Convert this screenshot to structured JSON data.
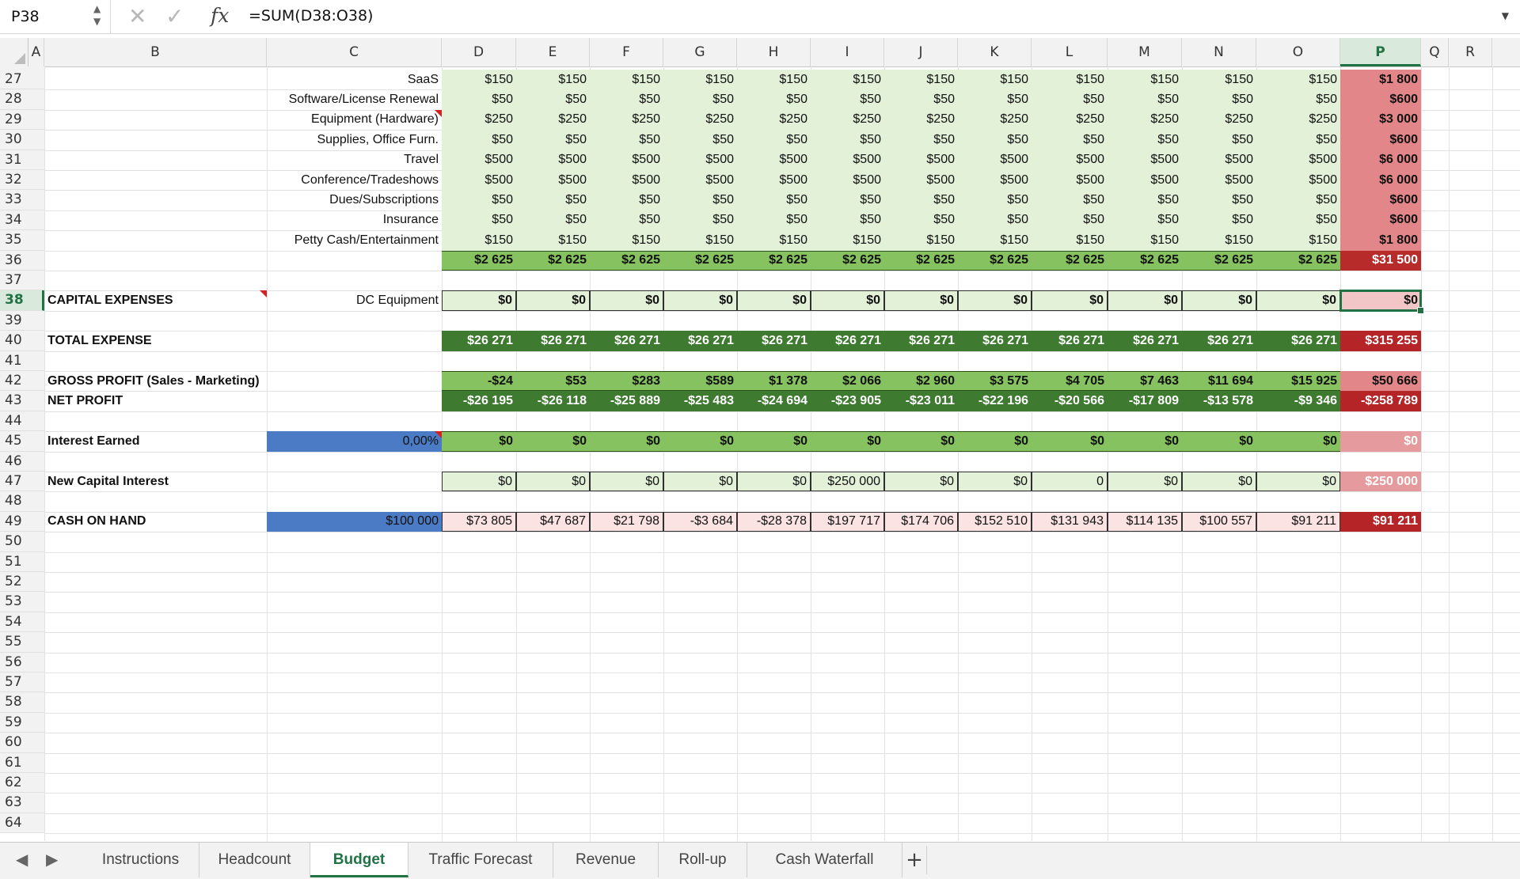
{
  "formula_bar": {
    "name_box": "P38",
    "name_box_stepper": "▲\n▼",
    "cancel_icon": "✕",
    "confirm_icon": "✓",
    "fx_icon": "fx",
    "formula": "=SUM(D38:O38)",
    "expand_icon": "▼"
  },
  "columns": [
    "A",
    "B",
    "C",
    "D",
    "E",
    "F",
    "G",
    "H",
    "I",
    "J",
    "K",
    "L",
    "M",
    "N",
    "O",
    "P",
    "Q",
    "R"
  ],
  "selected_column": "P",
  "rows": [
    {
      "n": "27",
      "c": "SaaS",
      "vals": [
        "$150",
        "$150",
        "$150",
        "$150",
        "$150",
        "$150",
        "$150",
        "$150",
        "$150",
        "$150",
        "$150",
        "$150"
      ],
      "total": "$1 800"
    },
    {
      "n": "28",
      "c": "Software/License Renewal",
      "vals": [
        "$50",
        "$50",
        "$50",
        "$50",
        "$50",
        "$50",
        "$50",
        "$50",
        "$50",
        "$50",
        "$50",
        "$50"
      ],
      "total": "$600"
    },
    {
      "n": "29",
      "c": "Equipment (Hardware)",
      "vals": [
        "$250",
        "$250",
        "$250",
        "$250",
        "$250",
        "$250",
        "$250",
        "$250",
        "$250",
        "$250",
        "$250",
        "$250"
      ],
      "total": "$3 000"
    },
    {
      "n": "30",
      "c": "Supplies, Office Furn.",
      "vals": [
        "$50",
        "$50",
        "$50",
        "$50",
        "$50",
        "$50",
        "$50",
        "$50",
        "$50",
        "$50",
        "$50",
        "$50"
      ],
      "total": "$600"
    },
    {
      "n": "31",
      "c": "Travel",
      "vals": [
        "$500",
        "$500",
        "$500",
        "$500",
        "$500",
        "$500",
        "$500",
        "$500",
        "$500",
        "$500",
        "$500",
        "$500"
      ],
      "total": "$6 000"
    },
    {
      "n": "32",
      "c": "Conference/Tradeshows",
      "vals": [
        "$500",
        "$500",
        "$500",
        "$500",
        "$500",
        "$500",
        "$500",
        "$500",
        "$500",
        "$500",
        "$500",
        "$500"
      ],
      "total": "$6 000"
    },
    {
      "n": "33",
      "c": "Dues/Subscriptions",
      "vals": [
        "$50",
        "$50",
        "$50",
        "$50",
        "$50",
        "$50",
        "$50",
        "$50",
        "$50",
        "$50",
        "$50",
        "$50"
      ],
      "total": "$600"
    },
    {
      "n": "34",
      "c": "Insurance",
      "vals": [
        "$50",
        "$50",
        "$50",
        "$50",
        "$50",
        "$50",
        "$50",
        "$50",
        "$50",
        "$50",
        "$50",
        "$50"
      ],
      "total": "$600"
    },
    {
      "n": "35",
      "c": "Petty Cash/Entertainment",
      "vals": [
        "$150",
        "$150",
        "$150",
        "$150",
        "$150",
        "$150",
        "$150",
        "$150",
        "$150",
        "$150",
        "$150",
        "$150"
      ],
      "total": "$1 800"
    }
  ],
  "subtotal": {
    "n": "36",
    "vals": [
      "$2 625",
      "$2 625",
      "$2 625",
      "$2 625",
      "$2 625",
      "$2 625",
      "$2 625",
      "$2 625",
      "$2 625",
      "$2 625",
      "$2 625",
      "$2 625"
    ],
    "total": "$31 500"
  },
  "capital": {
    "n": "38",
    "label": "CAPITAL EXPENSES",
    "c": "DC Equipment",
    "vals": [
      "$0",
      "$0",
      "$0",
      "$0",
      "$0",
      "$0",
      "$0",
      "$0",
      "$0",
      "$0",
      "$0",
      "$0"
    ],
    "total": "$0"
  },
  "total_expense": {
    "n": "40",
    "label": "TOTAL EXPENSE",
    "vals": [
      "$26 271",
      "$26 271",
      "$26 271",
      "$26 271",
      "$26 271",
      "$26 271",
      "$26 271",
      "$26 271",
      "$26 271",
      "$26 271",
      "$26 271",
      "$26 271"
    ],
    "total": "$315 255"
  },
  "gross_profit": {
    "n": "42",
    "label": "GROSS PROFIT (Sales - Marketing)",
    "vals": [
      "-$24",
      "$53",
      "$283",
      "$589",
      "$1 378",
      "$2 066",
      "$2 960",
      "$3 575",
      "$4 705",
      "$7 463",
      "$11 694",
      "$15 925"
    ],
    "total": "$50 666"
  },
  "net_profit": {
    "n": "43",
    "label": "NET PROFIT",
    "vals": [
      "-$26 195",
      "-$26 118",
      "-$25 889",
      "-$25 483",
      "-$24 694",
      "-$23 905",
      "-$23 011",
      "-$22 196",
      "-$20 566",
      "-$17 809",
      "-$13 578",
      "-$9 346"
    ],
    "total": "-$258 789"
  },
  "interest": {
    "n": "45",
    "label": "Interest Earned",
    "c": "0,00%",
    "vals": [
      "$0",
      "$0",
      "$0",
      "$0",
      "$0",
      "$0",
      "$0",
      "$0",
      "$0",
      "$0",
      "$0",
      "$0"
    ],
    "total": "$0"
  },
  "new_capital": {
    "n": "47",
    "label": "New Capital Interest",
    "vals": [
      "$0",
      "$0",
      "$0",
      "$0",
      "$0",
      "$250 000",
      "$0",
      "$0",
      "0",
      "$0",
      "$0",
      "$0"
    ],
    "total": "$250 000"
  },
  "cash": {
    "n": "49",
    "label": "CASH ON HAND",
    "c": "$100 000",
    "vals": [
      "$73 805",
      "$47 687",
      "$21 798",
      "-$3 684",
      "-$28 378",
      "$197 717",
      "$174 706",
      "$152 510",
      "$131 943",
      "$114 135",
      "$100 557",
      "$91 211"
    ],
    "total": "$91 211"
  },
  "empty_rows": [
    "37",
    "39",
    "41",
    "44",
    "46",
    "48",
    "50",
    "51",
    "52",
    "53",
    "54",
    "55",
    "56",
    "57",
    "58",
    "59",
    "60",
    "61",
    "62",
    "63",
    "64"
  ],
  "selected_row": "38",
  "tabs": {
    "prev_icon": "◀",
    "next_icon": "▶",
    "items": [
      "Instructions",
      "Headcount",
      "Budget",
      "Traffic Forecast",
      "Revenue",
      "Roll-up",
      "Cash Waterfall"
    ],
    "active": "Budget",
    "add_icon": "+"
  },
  "colors": {
    "accent": "#217346",
    "light_green": "#e3f1d8",
    "mid_green": "#86c25f",
    "dark_green": "#3e7a30",
    "pink": "#e2868a",
    "dark_red": "#b72b2b",
    "blue": "#4a7bc4"
  }
}
